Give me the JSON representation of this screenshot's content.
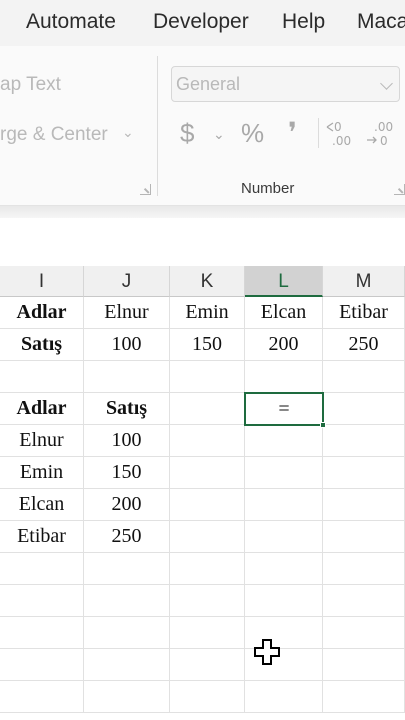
{
  "menu": {
    "items": [
      "Automate",
      "Developer",
      "Help",
      "Maca"
    ]
  },
  "ribbon": {
    "wrap_text": "ap Text",
    "merge_center": "rge & Center",
    "number_format_value": "General",
    "number_group_label": "Number",
    "currency_symbol": "$",
    "percent_symbol": "%",
    "comma_symbol": "❜"
  },
  "sheet": {
    "columns": [
      "I",
      "J",
      "K",
      "L",
      "M"
    ],
    "active_column": "L",
    "rows": [
      [
        "Adlar",
        "Elnur",
        "Emin",
        "Elcan",
        "Etibar"
      ],
      [
        "Satış",
        "100",
        "150",
        "200",
        "250"
      ],
      [
        "",
        "",
        "",
        "",
        ""
      ],
      [
        "Adlar",
        "Satış",
        "",
        "",
        ""
      ],
      [
        "Elnur",
        "100",
        "",
        "",
        ""
      ],
      [
        "Emin",
        "150",
        "",
        "",
        ""
      ],
      [
        "Elcan",
        "200",
        "",
        "",
        ""
      ],
      [
        "Etibar",
        "250",
        "",
        "",
        ""
      ],
      [
        "",
        "",
        "",
        "",
        ""
      ],
      [
        "",
        "",
        "",
        "",
        ""
      ],
      [
        "",
        "",
        "",
        "",
        ""
      ],
      [
        "",
        "",
        "",
        "",
        ""
      ],
      [
        "",
        "",
        "",
        "",
        ""
      ]
    ],
    "selected_cell_text": "="
  },
  "colors": {
    "accent": "#1e6b3f"
  }
}
